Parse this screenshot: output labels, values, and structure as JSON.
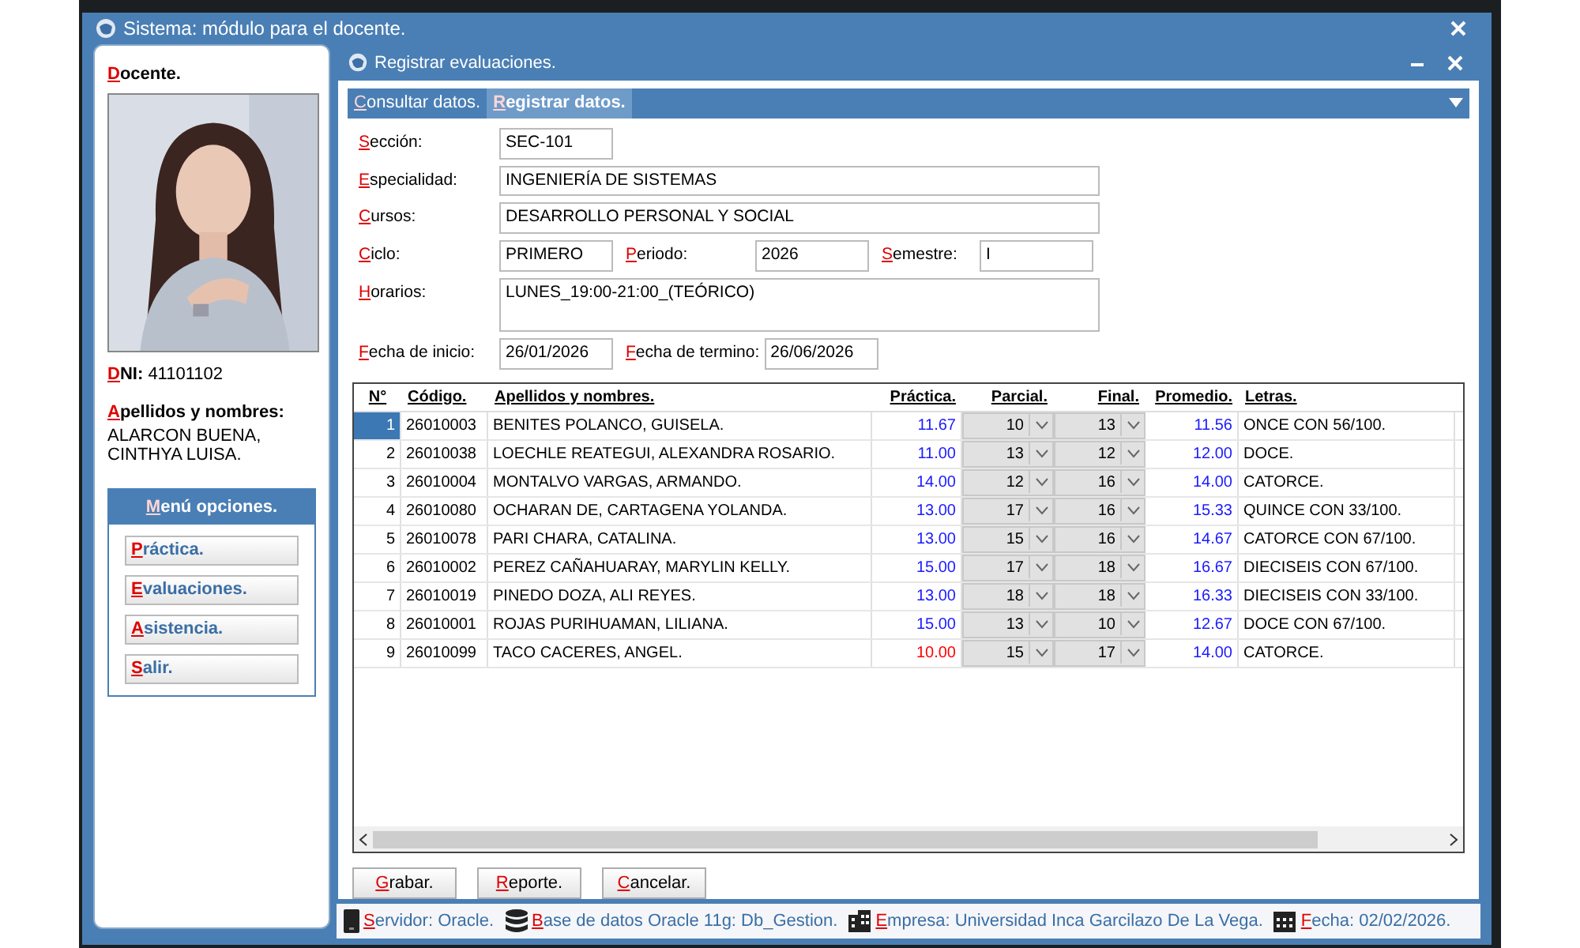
{
  "window": {
    "title": "Sistema: módulo para el docente."
  },
  "docente": {
    "heading": "Docente.",
    "dni_label": "DNI:",
    "dni": "41101102",
    "name_label": "Apellidos y nombres:",
    "name": "ALARCON BUENA, CINTHYA LUISA."
  },
  "menu": {
    "title": "Menú opciones.",
    "items": [
      "Práctica.",
      "Evaluaciones.",
      "Asistencia.",
      "Salir."
    ]
  },
  "subwindow": {
    "title": "Registrar evaluaciones."
  },
  "tabs": [
    {
      "label": "Consultar datos.",
      "selected": false
    },
    {
      "label": "Registrar datos.",
      "selected": true
    }
  ],
  "form": [
    [
      {
        "label": "Sección:",
        "value": "SEC-101",
        "kind": "short"
      }
    ],
    [
      {
        "label": "Especialidad:",
        "value": "INGENIERÍA DE SISTEMAS",
        "kind": "wide"
      }
    ],
    [
      {
        "label": "Cursos:",
        "value": "DESARROLLO PERSONAL Y SOCIAL",
        "kind": "wide"
      }
    ],
    [
      {
        "label": "Ciclo:",
        "value": "PRIMERO",
        "kind": "short"
      },
      {
        "label": "Periodo:",
        "value": "2026",
        "kind": "short"
      },
      {
        "label": "Semestre:",
        "value": "I",
        "kind": "short"
      }
    ],
    [
      {
        "label": "Horarios:",
        "value": "LUNES_19:00-21:00_(TEÓRICO)",
        "kind": "area"
      }
    ],
    [
      {
        "label": "Fecha de inicio:",
        "value": "26/01/2026",
        "kind": "short"
      },
      {
        "label": "Fecha de termino:",
        "value": "26/06/2026",
        "kind": "short"
      }
    ]
  ],
  "table": {
    "columns": [
      "N°",
      "Código.",
      "Apellidos y nombres.",
      "Práctica.",
      "Parcial.",
      "Final.",
      "Promedio.",
      "Letras."
    ],
    "rows": [
      {
        "n": "1",
        "codigo": "26010003",
        "nombre": "BENITES POLANCO, GUISELA.",
        "practica": "11.67",
        "failing": false,
        "parcial": "10",
        "final": "13",
        "promedio": "11.56",
        "letras": "ONCE CON 56/100.",
        "selected": true
      },
      {
        "n": "2",
        "codigo": "26010038",
        "nombre": "LOECHLE REATEGUI, ALEXANDRA ROSARIO.",
        "practica": "11.00",
        "failing": false,
        "parcial": "13",
        "final": "12",
        "promedio": "12.00",
        "letras": "DOCE.",
        "selected": false
      },
      {
        "n": "3",
        "codigo": "26010004",
        "nombre": "MONTALVO VARGAS, ARMANDO.",
        "practica": "14.00",
        "failing": false,
        "parcial": "12",
        "final": "16",
        "promedio": "14.00",
        "letras": "CATORCE.",
        "selected": false
      },
      {
        "n": "4",
        "codigo": "26010080",
        "nombre": "OCHARAN DE, CARTAGENA YOLANDA.",
        "practica": "13.00",
        "failing": false,
        "parcial": "17",
        "final": "16",
        "promedio": "15.33",
        "letras": "QUINCE CON 33/100.",
        "selected": false
      },
      {
        "n": "5",
        "codigo": "26010078",
        "nombre": "PARI CHARA, CATALINA.",
        "practica": "13.00",
        "failing": false,
        "parcial": "15",
        "final": "16",
        "promedio": "14.67",
        "letras": "CATORCE CON 67/100.",
        "selected": false
      },
      {
        "n": "6",
        "codigo": "26010002",
        "nombre": "PEREZ CAÑAHUARAY, MARYLIN KELLY.",
        "practica": "15.00",
        "failing": false,
        "parcial": "17",
        "final": "18",
        "promedio": "16.67",
        "letras": "DIECISEIS CON 67/100.",
        "selected": false
      },
      {
        "n": "7",
        "codigo": "26010019",
        "nombre": "PINEDO DOZA, ALI REYES.",
        "practica": "13.00",
        "failing": false,
        "parcial": "18",
        "final": "18",
        "promedio": "16.33",
        "letras": "DIECISEIS CON 33/100.",
        "selected": false
      },
      {
        "n": "8",
        "codigo": "26010001",
        "nombre": "ROJAS PURIHUAMAN, LILIANA.",
        "practica": "15.00",
        "failing": false,
        "parcial": "13",
        "final": "10",
        "promedio": "12.67",
        "letras": "DOCE CON 67/100.",
        "selected": false
      },
      {
        "n": "9",
        "codigo": "26010099",
        "nombre": "TACO CACERES, ANGEL.",
        "practica": "10.00",
        "failing": true,
        "parcial": "15",
        "final": "17",
        "promedio": "14.00",
        "letras": "CATORCE.",
        "selected": false
      }
    ]
  },
  "buttons": [
    "Grabar.",
    "Reporte.",
    "Cancelar."
  ],
  "status_bar": [
    {
      "kind": "server",
      "label": "Servidor:",
      "value": "Oracle."
    },
    {
      "kind": "database",
      "label": "Base de datos Oracle 11g:",
      "value": "Db_Gestion."
    },
    {
      "kind": "company",
      "label": "Empresa:",
      "value": "Universidad Inca Garcilazo De La Vega."
    },
    {
      "kind": "date",
      "label": "Fecha:",
      "value": "02/02/2026."
    }
  ]
}
